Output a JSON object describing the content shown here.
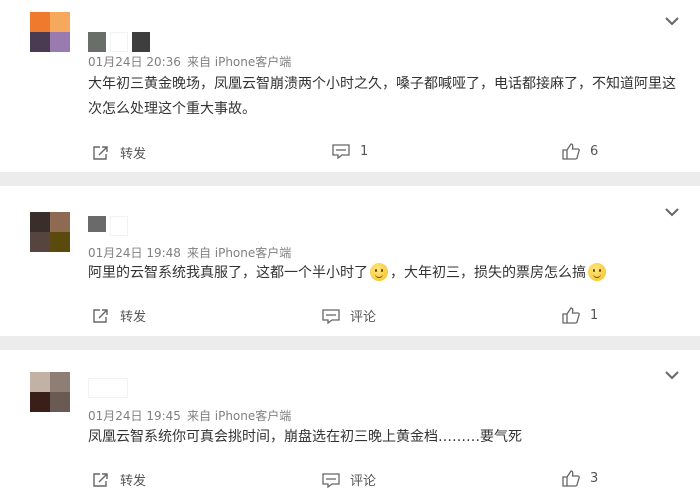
{
  "comments": [
    {
      "time": "01月24日 20:36",
      "source": "来自 iPhone客户端",
      "text": "大年初三黄金晚场，凤凰云智崩溃两个小时之久，嗓子都喊哑了，电话都接麻了，不知道阿里这次怎么处理这个重大事故。",
      "forward_label": "转发",
      "comment_label": "1",
      "like_count": "6",
      "avatar_colors": [
        "#ef7a2e",
        "#f6a85c",
        "#4a3a52",
        "#9a7bb0"
      ],
      "name_colors": [
        "#6a6e6a",
        "#ffffff",
        "#3e3e3e"
      ]
    },
    {
      "time": "01月24日 19:48",
      "source": "来自 iPhone客户端",
      "text_a": "阿里的云智系统我真服了，这都一个半小时了",
      "text_b": "，大年初三，损失的票房怎么搞",
      "forward_label": "转发",
      "comment_label": "评论",
      "like_count": "1",
      "avatar_colors": [
        "#3a2e2a",
        "#8e6a52",
        "#56443e",
        "#5a4a0e"
      ],
      "name_colors": [
        "#6a6a6a",
        "#ffffff"
      ]
    },
    {
      "time": "01月24日 19:45",
      "source": "来自 iPhone客户端",
      "text": "凤凰云智系统你可真会挑时间，崩盘选在初三晚上黄金档………要气死",
      "forward_label": "转发",
      "comment_label": "评论",
      "like_count": "3",
      "avatar_colors": [
        "#c2b2a6",
        "#8e7e74",
        "#3a1e18",
        "#6a5a54"
      ],
      "name_colors": [
        "#ffffff"
      ]
    }
  ],
  "icons": {
    "expand": "chevron-down-icon",
    "forward": "forward-icon",
    "comment": "comment-icon",
    "like": "thumbs-up-icon"
  }
}
